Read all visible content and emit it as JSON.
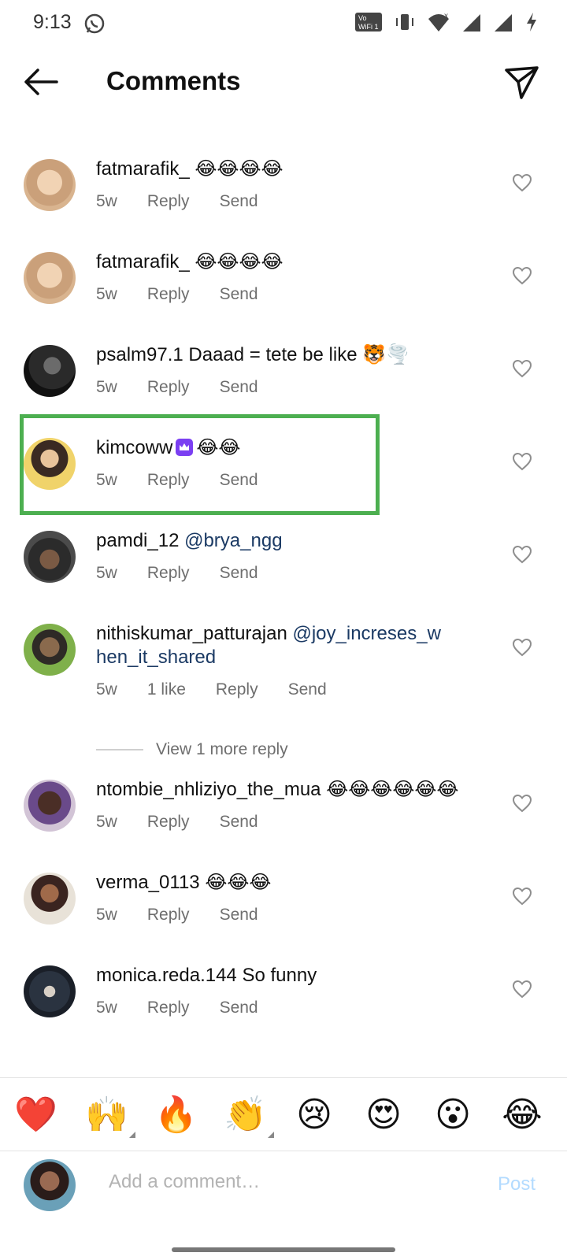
{
  "status_bar": {
    "time": "9:13",
    "left_icon": "whatsapp-icon",
    "right_icons": [
      "vowifi-icon",
      "vibrate-icon",
      "wifi-icon",
      "signal-icon",
      "signal-icon",
      "charging-icon"
    ]
  },
  "header": {
    "title": "Comments",
    "back_icon": "back-arrow-icon",
    "share_icon": "send-icon"
  },
  "comments": [
    {
      "username": "fatmarafik_",
      "text": "😂😂😂😂",
      "time": "5w",
      "reply": "Reply",
      "send": "Send"
    },
    {
      "username": "fatmarafik_",
      "text": "😂😂😂😂",
      "time": "5w",
      "reply": "Reply",
      "send": "Send"
    },
    {
      "username": "psalm97.1",
      "text": "Daaad = tete be like 🐯🌪️",
      "time": "5w",
      "reply": "Reply",
      "send": "Send"
    },
    {
      "username": "kimcoww",
      "badge": "crown-badge",
      "text": "😂😂",
      "time": "5w",
      "reply": "Reply",
      "send": "Send"
    },
    {
      "username": "pamdi_12",
      "mention": "@brya_ngg",
      "time": "5w",
      "reply": "Reply",
      "send": "Send"
    },
    {
      "username": "nithiskumar_patturajan",
      "mention": "@joy_increses_when_it_shared",
      "time": "5w",
      "likes": "1 like",
      "reply": "Reply",
      "send": "Send"
    },
    {
      "username": "ntombie_nhliziyo_the_mua",
      "text": "😂😂😂😂😂😂",
      "time": "5w",
      "reply": "Reply",
      "send": "Send"
    },
    {
      "username": "verma_0113",
      "text": "😂😂😂",
      "time": "5w",
      "reply": "Reply",
      "send": "Send"
    },
    {
      "username": "monica.reda.144",
      "text": "So funny",
      "time": "5w",
      "reply": "Reply",
      "send": "Send"
    }
  ],
  "view_more": "View 1 more reply",
  "emoji_bar": [
    "❤️",
    "🙌",
    "🔥",
    "👏",
    "😢",
    "😍",
    "😮",
    "😂"
  ],
  "composer": {
    "placeholder": "Add a comment…",
    "post_label": "Post"
  },
  "colors": {
    "highlight": "#4caf50",
    "mention": "#1b3a64",
    "post_disabled": "#b3dbff",
    "meta": "#6e6e6e"
  }
}
